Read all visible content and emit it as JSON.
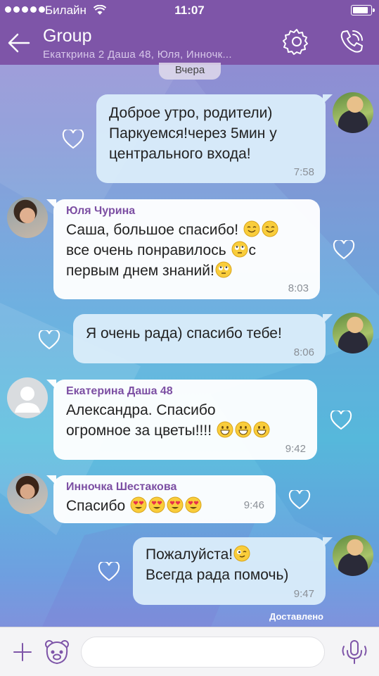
{
  "status_bar": {
    "carrier": "Билайн",
    "time": "11:07",
    "battery_level": 0.9
  },
  "header": {
    "title": "Group",
    "subtitle": "Екаткрина 2 Даша 48, Юля, Инночк..."
  },
  "date_separator": "Вчера",
  "messages": [
    {
      "direction": "outgoing",
      "text": "Доброе утро, родители)\nПаркуемся!через 5мин у\nцентрального входа!",
      "time": "7:58"
    },
    {
      "direction": "incoming",
      "sender": "Юля Чурина",
      "lines": [
        "Саша, большое спасибо!",
        "все очень понравилось",
        "с",
        "первым днем знаний!"
      ],
      "time": "8:03"
    },
    {
      "direction": "outgoing",
      "text": "Я очень рада) спасибо тебе!",
      "time": "8:06"
    },
    {
      "direction": "incoming",
      "sender": "Екатерина Даша 48",
      "lines": [
        "Александра. Спасибо",
        "огромное за цветы!!!!"
      ],
      "time": "9:42"
    },
    {
      "direction": "incoming",
      "sender": "Инночка Шестакова",
      "lines": [
        "Спасибо"
      ],
      "time": "9:46"
    },
    {
      "direction": "outgoing",
      "lines": [
        "Пожалуйста!",
        "Всегда рада помочь)"
      ],
      "time": "9:47"
    }
  ],
  "delivery_status": "Доставлено",
  "composer": {
    "placeholder": ""
  },
  "colors": {
    "header": "#7e55a8",
    "sender_name": "#7c4fa3",
    "outgoing_bubble": "#daecfa",
    "incoming_bubble": "#ffffff"
  },
  "icons": [
    "back-arrow-icon",
    "gear-icon",
    "call-icon",
    "heart-icon",
    "plus-icon",
    "sticker-bear-icon",
    "microphone-icon",
    "wifi-icon",
    "battery-icon"
  ]
}
